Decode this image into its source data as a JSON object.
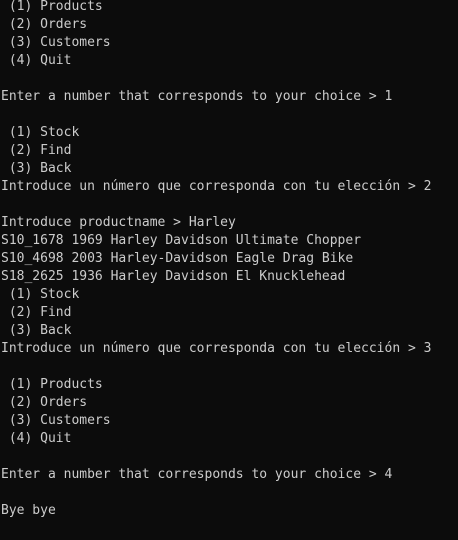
{
  "terminal": {
    "lines": [
      " (1) Products",
      " (2) Orders",
      " (3) Customers",
      " (4) Quit",
      "",
      "Enter a number that corresponds to your choice > 1",
      "",
      " (1) Stock",
      " (2) Find",
      " (3) Back",
      "Introduce un número que corresponda con tu elección > 2",
      "",
      "Introduce productname > Harley",
      "S10_1678 1969 Harley Davidson Ultimate Chopper",
      "S10_4698 2003 Harley-Davidson Eagle Drag Bike",
      "S18_2625 1936 Harley Davidson El Knucklehead",
      " (1) Stock",
      " (2) Find",
      " (3) Back",
      "Introduce un número que corresponda con tu elección > 3",
      "",
      " (1) Products",
      " (2) Orders",
      " (3) Customers",
      " (4) Quit",
      "",
      "Enter a number that corresponds to your choice > 4",
      "",
      "Bye bye"
    ]
  }
}
